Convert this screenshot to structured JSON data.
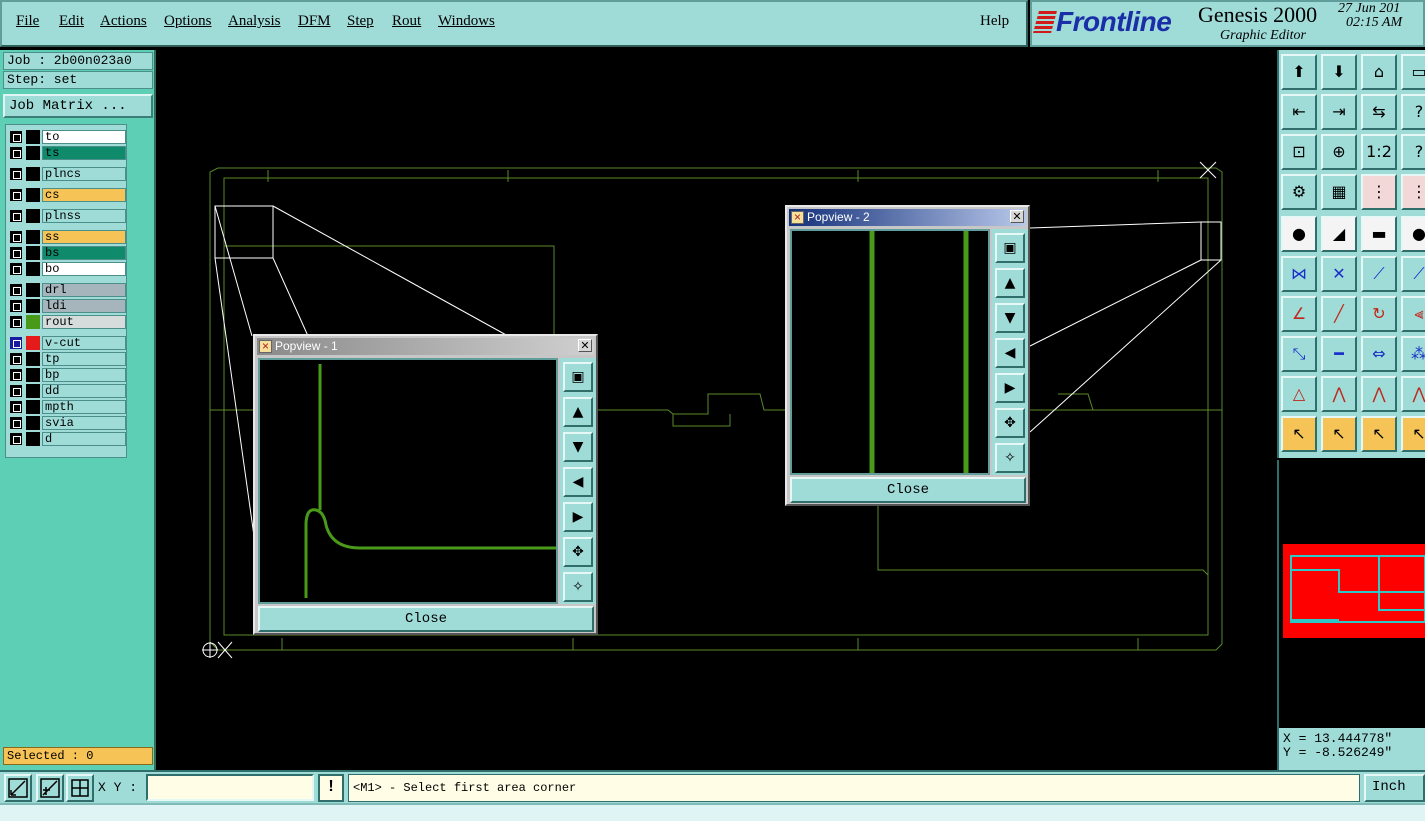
{
  "menu": {
    "items": [
      "File",
      "Edit",
      "Actions",
      "Options",
      "Analysis",
      "DFM",
      "Step",
      "Rout",
      "Windows"
    ],
    "help": "Help"
  },
  "brand": {
    "logo": "Frontline",
    "product": "Genesis 2000",
    "subtitle": "Graphic Editor",
    "date": "27 Jun 201",
    "time": "02:15 AM"
  },
  "job": {
    "job_label": "Job : 2b00n023a0",
    "step_label": "Step: set",
    "matrix_button": "Job Matrix ..."
  },
  "layers": [
    {
      "name": "to",
      "color": "#ffffff",
      "swatch": "#000000"
    },
    {
      "name": "ts",
      "color": "#0f8a6a",
      "swatch": "#000000"
    },
    {
      "name": "plncs",
      "color": "#9fdcd8",
      "swatch": "#000000"
    },
    {
      "name": "cs",
      "color": "#f6c456",
      "swatch": "#000000"
    },
    {
      "name": "plnss",
      "color": "#9fdcd8",
      "swatch": "#000000"
    },
    {
      "name": "ss",
      "color": "#f6c456",
      "swatch": "#000000"
    },
    {
      "name": "bs",
      "color": "#0f8a6a",
      "swatch": "#000000"
    },
    {
      "name": "bo",
      "color": "#ffffff",
      "swatch": "#000000"
    },
    {
      "name": "drl",
      "color": "#a6b4bc",
      "swatch": "#000000"
    },
    {
      "name": "ldi",
      "color": "#a6b4bc",
      "swatch": "#000000"
    },
    {
      "name": "rout",
      "color": "#d6dcdc",
      "swatch": "#4a9a1a"
    },
    {
      "name": "v-cut",
      "color": "#9fdcd8",
      "swatch": "#e51a1a"
    },
    {
      "name": "tp",
      "color": "#9fdcd8",
      "swatch": "#000000"
    },
    {
      "name": "bp",
      "color": "#9fdcd8",
      "swatch": "#000000"
    },
    {
      "name": "dd",
      "color": "#9fdcd8",
      "swatch": "#000000"
    },
    {
      "name": "mpth",
      "color": "#9fdcd8",
      "swatch": "#000000"
    },
    {
      "name": "svia",
      "color": "#9fdcd8",
      "swatch": "#000000"
    },
    {
      "name": "d",
      "color": "#9fdcd8",
      "swatch": "#000000"
    }
  ],
  "selected": "Selected : 0",
  "popview1": {
    "title": "Popview - 1",
    "close_label": "Close"
  },
  "popview2": {
    "title": "Popview - 2",
    "close_label": "Close"
  },
  "coords": {
    "x": "X = 13.444778\"",
    "y": "Y = -8.526249\""
  },
  "status": {
    "xy_label": "X Y :",
    "xy_value": "",
    "prompt": "<M1> - Select first area corner",
    "units": "Inch"
  },
  "colors": {
    "panel": "#9fdcd8",
    "panel_green": "#5ccfb5",
    "rout_green": "#4a9a1a",
    "outline_green": "#5a8a2a",
    "overview_red": "#ff0000"
  }
}
